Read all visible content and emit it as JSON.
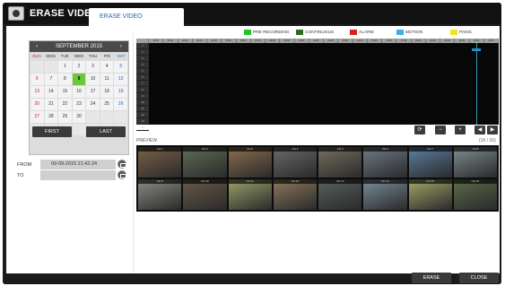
{
  "window": {
    "title": "ERASE VIDEO",
    "tab_label": "ERASE VIDEO"
  },
  "calendar": {
    "month_label": "SEPTEMBER 2015",
    "prev_icon": "‹",
    "next_icon": "›",
    "weekdays": [
      "SUN",
      "MON",
      "TUE",
      "WED",
      "THU",
      "FRI",
      "SAT"
    ],
    "weeks": [
      [
        "",
        "",
        "1",
        "2",
        "3",
        "4",
        "5"
      ],
      [
        "6",
        "7",
        "8",
        "9",
        "10",
        "11",
        "12"
      ],
      [
        "13",
        "14",
        "15",
        "16",
        "17",
        "18",
        "19"
      ],
      [
        "20",
        "21",
        "22",
        "23",
        "24",
        "25",
        "26"
      ],
      [
        "27",
        "28",
        "29",
        "30",
        "",
        "",
        ""
      ],
      [
        "",
        "",
        "",
        "",
        "",
        "",
        ""
      ]
    ],
    "selected_day": "9",
    "first_label": "FIRST",
    "last_label": "LAST"
  },
  "range": {
    "from_label": "FROM",
    "from_value": "09-09-2015 21:42:24",
    "to_label": "TO",
    "to_value": ""
  },
  "legend": [
    {
      "label": "PRE RECORDING",
      "color": "#22c422"
    },
    {
      "label": "CONTINUOUS",
      "color": "#2d6b1f"
    },
    {
      "label": "ALARM",
      "color": "#d81f1f"
    },
    {
      "label": "MOTION",
      "color": "#3ab0e6"
    },
    {
      "label": "PANIC",
      "color": "#f2e41c"
    }
  ],
  "timeline": {
    "hours": [
      "00:00",
      "01:00",
      "02:00",
      "03:00",
      "04:00",
      "05:00",
      "06:00",
      "07:00",
      "08:00",
      "09:00",
      "10:00",
      "11:00",
      "12:00",
      "13:00",
      "14:00",
      "15:00",
      "16:00",
      "17:00",
      "18:00",
      "19:00",
      "20:00",
      "21:00",
      "22:00",
      "23:00"
    ],
    "rows": [
      "1",
      "2",
      "3",
      "4",
      "5",
      "6",
      "7",
      "8",
      "9",
      "10",
      "11",
      "12",
      "13",
      "14"
    ]
  },
  "preview": {
    "label": "PREVIEW",
    "count": "(16 / 16)"
  },
  "thumbnails": [
    {
      "caption": "CH 1",
      "bg": "#7a6248"
    },
    {
      "caption": "CH 2",
      "bg": "#5f6e55"
    },
    {
      "caption": "CH 3",
      "bg": "#8a6e4e"
    },
    {
      "caption": "CH 4",
      "bg": "#6a6a6a"
    },
    {
      "caption": "CH 5",
      "bg": "#75705f"
    },
    {
      "caption": "CH 6",
      "bg": "#6f7b86"
    },
    {
      "caption": "CH 7",
      "bg": "#5d7fa3"
    },
    {
      "caption": "CH 8",
      "bg": "#7d8d8f"
    },
    {
      "caption": "CH 9",
      "bg": "#8c8c86"
    },
    {
      "caption": "CH 10",
      "bg": "#6a5a4a"
    },
    {
      "caption": "CH 11",
      "bg": "#99a36a"
    },
    {
      "caption": "CH 12",
      "bg": "#8c7a5e"
    },
    {
      "caption": "CH 13",
      "bg": "#5a6060"
    },
    {
      "caption": "CH 14",
      "bg": "#7a8e9a"
    },
    {
      "caption": "CH 15",
      "bg": "#a3a76a"
    },
    {
      "caption": "CH 16",
      "bg": "#5e6a4a"
    }
  ],
  "controls": {
    "refresh_icon": "⟳",
    "zoom_out_icon": "−",
    "zoom_in_icon": "+",
    "prev_icon": "◀",
    "next_icon": "▶"
  },
  "buttons": {
    "erase_label": "ERASE",
    "close_label": "CLOSE"
  }
}
